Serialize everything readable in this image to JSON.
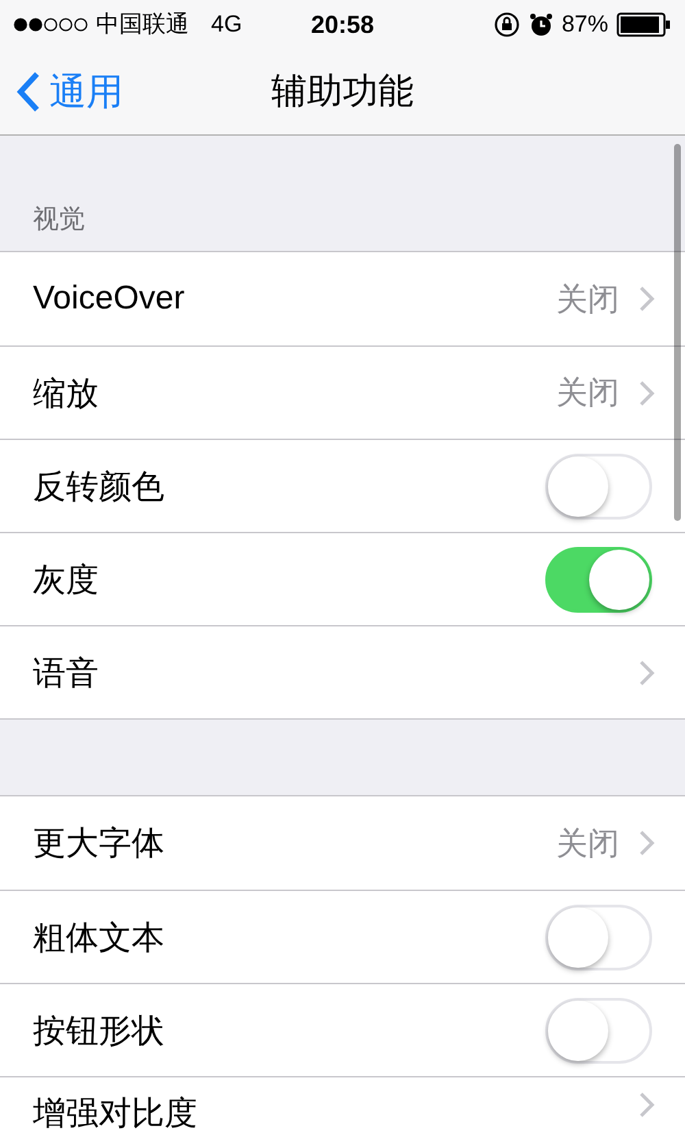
{
  "status_bar": {
    "carrier": "中国联通",
    "network": "4G",
    "time": "20:58",
    "battery": "87%"
  },
  "nav": {
    "back": "通用",
    "title": "辅助功能"
  },
  "sections": [
    {
      "header": "视觉",
      "rows": [
        {
          "kind": "link",
          "label": "VoiceOver",
          "value": "关闭"
        },
        {
          "kind": "link",
          "label": "缩放",
          "value": "关闭"
        },
        {
          "kind": "switch",
          "label": "反转颜色",
          "on": false
        },
        {
          "kind": "switch",
          "label": "灰度",
          "on": true
        },
        {
          "kind": "link",
          "label": "语音"
        }
      ]
    },
    {
      "rows": [
        {
          "kind": "link",
          "label": "更大字体",
          "value": "关闭"
        },
        {
          "kind": "switch",
          "label": "粗体文本",
          "on": false
        },
        {
          "kind": "switch",
          "label": "按钮形状",
          "on": false
        },
        {
          "kind": "link",
          "label": "增强对比度"
        }
      ]
    }
  ]
}
